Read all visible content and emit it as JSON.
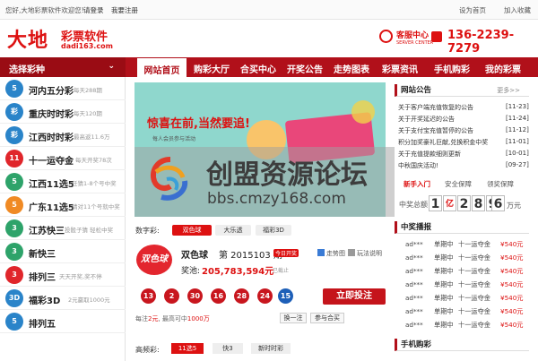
{
  "topbar": {
    "welcome": "您好,大地彩票软件欢迎您!",
    "login": "请登录",
    "register": "我要注册",
    "set_home": "设为首页",
    "add_fav": "加入收藏"
  },
  "header": {
    "logo_big": "大地",
    "logo_sub": "彩票软件",
    "logo_url": "dadi163.com",
    "service_title": "客服中心",
    "service_sub": "SERVER CENTER",
    "phone": "136-2239-7279"
  },
  "nav": {
    "select_label": "选择彩种",
    "items": [
      {
        "label": "网站首页"
      },
      {
        "label": "购彩大厅"
      },
      {
        "label": "合买中心"
      },
      {
        "label": "开奖公告"
      },
      {
        "label": "走势图表"
      },
      {
        "label": "彩票资讯"
      },
      {
        "label": "手机购彩"
      },
      {
        "label": "我的彩票"
      }
    ]
  },
  "sidebar": [
    {
      "ball": "5",
      "color": "#2a84c9",
      "name": "河内五分彩",
      "desc": "每天288期"
    },
    {
      "ball": "彩",
      "color": "#2a84c9",
      "name": "重庆时时彩",
      "desc": "每天120期"
    },
    {
      "ball": "彩",
      "color": "#2a84c9",
      "name": "江西时时彩",
      "desc": "最高返11.6万"
    },
    {
      "ball": "11",
      "color": "#e0262b",
      "name": "十一运夺金",
      "desc": "每天开奖78次"
    },
    {
      "ball": "5",
      "color": "#2ea36a",
      "name": "江西11选5",
      "desc": "任猜1-8个号中奖"
    },
    {
      "ball": "5",
      "color": "#f08a24",
      "name": "广东11选5",
      "desc": "猜对11个号就中奖"
    },
    {
      "ball": "3",
      "color": "#2ea36a",
      "name": "江苏快三",
      "desc": "投骰子猜  轻松中奖"
    },
    {
      "ball": "3",
      "color": "#2ea36a",
      "name": "新快三",
      "desc": ""
    },
    {
      "ball": "3",
      "color": "#e0262b",
      "name": "排列三",
      "desc": "天天开奖,奖不停"
    },
    {
      "ball": "3D",
      "color": "#2a84c9",
      "name": "福彩3D",
      "desc": "2元赢取1000元"
    },
    {
      "ball": "5",
      "color": "#2a84c9",
      "name": "排列五",
      "desc": ""
    }
  ],
  "banner": {
    "title": "惊喜在前,当然要追!",
    "sub": "每人会员参与活动"
  },
  "watermark": {
    "title": "创盟资源论坛",
    "url": "bbs.cmzy168.com"
  },
  "digital": {
    "label": "数字彩:",
    "tabs": [
      "双色球",
      "大乐透",
      "福彩3D"
    ]
  },
  "draw": {
    "logo": "双色球",
    "name": "双色球",
    "period": "第 2015103 期",
    "today": "今日开奖",
    "pool_label": "奖池:",
    "pool_value": "205,783,594元",
    "pool_end": "已截止",
    "trend": "走势图",
    "rules": "玩法说明",
    "balls": [
      "13",
      "2",
      "30",
      "16",
      "28",
      "24",
      "15"
    ],
    "bet": "立即投注",
    "note_pre": "每注",
    "note_price": "2元",
    "note_mid": ", 最高可中",
    "note_max": "1000万",
    "swap": "换一注",
    "join": "参与合买"
  },
  "hf": {
    "label": "高频彩:",
    "tabs": [
      "11选5",
      "快3",
      "新时时彩"
    ]
  },
  "notice": {
    "title": "网站公告",
    "more": "更多>>",
    "items": [
      {
        "t": "关于客户端充值恢复的公告",
        "d": "[11-23]"
      },
      {
        "t": "关于开奖延迟的公告",
        "d": "[11-24]"
      },
      {
        "t": "关于支付宝充值暂停的公告",
        "d": "[11-12]"
      },
      {
        "t": "积分加奖豪礼巨献,兑换积金中奖",
        "d": "[11-01]"
      },
      {
        "t": "关于充值提款细则更新",
        "d": "[10-01]"
      },
      {
        "t": "中秋国庆活动!",
        "d": "[09-27]"
      }
    ]
  },
  "quick": {
    "tabs": [
      "新手入门",
      "安全保障",
      "领奖保障"
    ]
  },
  "counter": {
    "label": "中奖总额",
    "digits": [
      "1",
      "亿",
      "2",
      "8",
      "9",
      "6"
    ],
    "unit": "万元"
  },
  "winners": {
    "title": "中奖播报",
    "rows": [
      {
        "u": "ad***",
        "a": "单期中",
        "g": "十一运夺金",
        "m": "¥540元"
      },
      {
        "u": "ad***",
        "a": "单期中",
        "g": "十一运夺金",
        "m": "¥540元"
      },
      {
        "u": "ad***",
        "a": "单期中",
        "g": "十一运夺金",
        "m": "¥540元"
      },
      {
        "u": "ad***",
        "a": "单期中",
        "g": "十一运夺金",
        "m": "¥540元"
      },
      {
        "u": "ad***",
        "a": "单期中",
        "g": "十一运夺金",
        "m": "¥540元"
      },
      {
        "u": "ad***",
        "a": "单期中",
        "g": "十一运夺金",
        "m": "¥540元"
      },
      {
        "u": "ad***",
        "a": "单期中",
        "g": "十一运夺金",
        "m": "¥540元"
      },
      {
        "u": "ad***",
        "a": "单期中",
        "g": "十一运夺金",
        "m": "¥540元"
      }
    ]
  },
  "mobile": {
    "title": "手机购彩"
  }
}
